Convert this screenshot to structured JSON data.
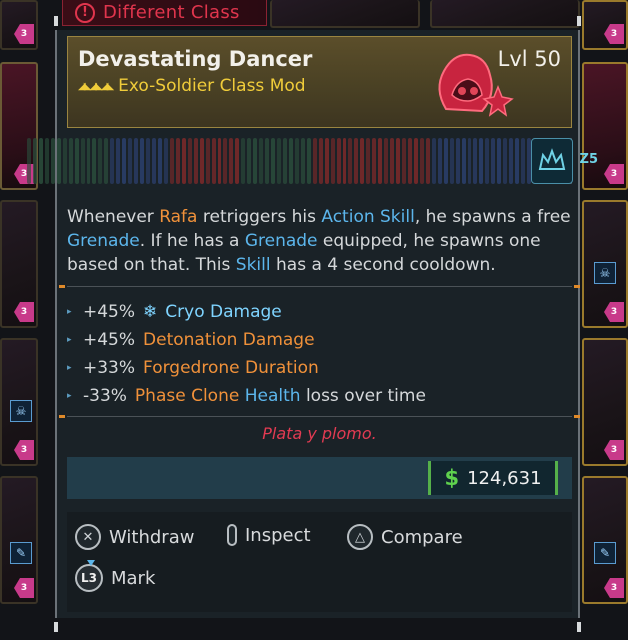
{
  "banner": {
    "text": "Different Class"
  },
  "item": {
    "name": "Devastating Dancer",
    "level": "Lvl 50",
    "type": "Exo-Soldier Class Mod"
  },
  "description": {
    "p1": "Whenever ",
    "rafa": "Rafa",
    "p2": " retriggers his ",
    "action_skill": "Action Skill",
    "p3": ", he spawns a free ",
    "grenade1": "Grenade",
    "p4": ". If he has a ",
    "grenade2": "Grenade",
    "p5": " equipped, he spawns one based on that. This ",
    "skill": "Skill",
    "p6": " has a 4 second cooldown."
  },
  "stats": [
    {
      "value": "+45%",
      "glyph": "❄",
      "label": "Cryo Damage",
      "color": "#7fd4ff"
    },
    {
      "value": "+45%",
      "label": "Detonation Damage",
      "color": "#f0913a"
    },
    {
      "value": "+33%",
      "label": "Forgedrone Duration",
      "color": "#f0913a"
    },
    {
      "value": "-33%",
      "label_orange": "Phase Clone",
      "label_blue": "Health",
      "label_rest": "loss over time"
    }
  ],
  "flavor": "Plata y plomo.",
  "price": {
    "symbol": "$",
    "value": "124,631"
  },
  "actions": {
    "withdraw": "Withdraw",
    "inspect": "Inspect",
    "compare": "Compare",
    "mark": "Mark",
    "l3": "L3",
    "cross_glyph": "✕",
    "triangle_glyph": "△"
  },
  "strip_tag": "Z5",
  "badge_value": "3",
  "colors": {
    "gold": "#f0cc3a",
    "orange": "#f0913a",
    "blue": "#5cb6ec",
    "red": "#e0354d",
    "green": "#5fd14e"
  },
  "icons": {
    "banner": "exclamation-icon",
    "class": "exo-soldier-class-icon",
    "cryo": "snowflake-icon",
    "currency": "dollar-icon"
  }
}
